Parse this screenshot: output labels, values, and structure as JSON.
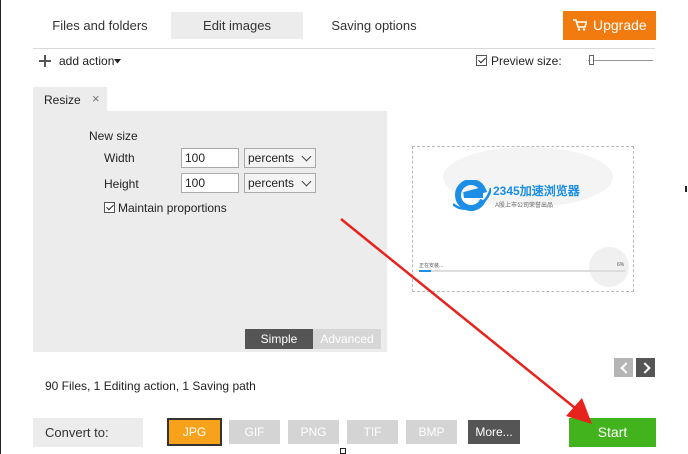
{
  "tabs": [
    {
      "label": "Files and folders"
    },
    {
      "label": "Edit images"
    },
    {
      "label": "Saving options"
    }
  ],
  "upgrade": {
    "label": "Upgrade"
  },
  "toolbar": {
    "add_action": "add action",
    "preview_size_label": "Preview size:",
    "preview_size_checked": true
  },
  "action_tab": {
    "label": "Resize"
  },
  "resize": {
    "section_title": "New size",
    "width_label": "Width",
    "width_value": "100",
    "width_unit": "percents",
    "height_label": "Height",
    "height_value": "100",
    "height_unit": "percents",
    "maintain_label": "Maintain proportions",
    "maintain_checked": true
  },
  "mode": {
    "simple": "Simple",
    "advanced": "Advanced"
  },
  "preview": {
    "brand_text": "2345加速浏览器",
    "tagline": "A股上市公司荣誉出品",
    "status_text": "正在安装...",
    "percent": "6%",
    "progress": 0.06
  },
  "status_bar": {
    "text": "90 Files, 1 Editing action, 1 Saving path"
  },
  "convert": {
    "label": "Convert to:",
    "formats": [
      "JPG",
      "GIF",
      "PNG",
      "TIF",
      "BMP"
    ],
    "selected": "JPG",
    "more": "More..."
  },
  "start": {
    "label": "Start"
  },
  "colors": {
    "accent_orange": "#f27b0f",
    "start_green": "#43b31d",
    "selected_format": "#f8a21b",
    "arrow_red": "#e8231d"
  }
}
